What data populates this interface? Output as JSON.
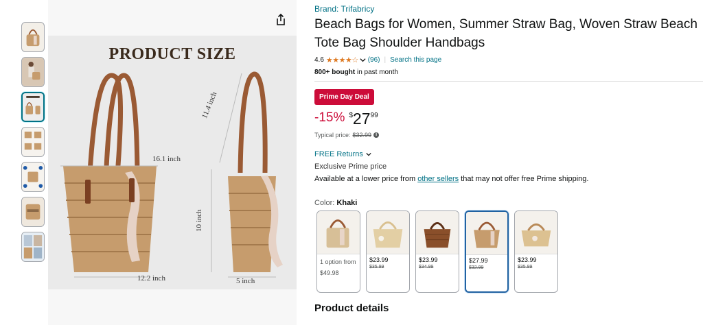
{
  "product": {
    "brand": "Brand: Trifabricy",
    "title": "Beach Bags for Women, Summer Straw Bag, Woven Straw Beach Tote Bag Shoulder Handbags",
    "rating": "4.6",
    "stars": "★★★★☆",
    "review_count": "(96)",
    "search_link": "Search this page",
    "bought_bold": "800+ bought",
    "bought_rest": " in past month"
  },
  "deal": {
    "badge": "Prime Day Deal",
    "discount": "-15%",
    "currency": "$",
    "whole": "27",
    "fraction": "99",
    "typical_label": "Typical price:",
    "typical_price": "$32.99",
    "info": "i"
  },
  "shipping": {
    "returns": "FREE Returns",
    "exclusive": "Exclusive Prime price",
    "lower_pre": "Available at a lower price from ",
    "lower_link": "other sellers",
    "lower_post": " that may not offer free Prime shipping."
  },
  "color": {
    "label": "Color: ",
    "selected": "Khaki",
    "options": [
      {
        "price": "1 option from $49.98",
        "strike": ""
      },
      {
        "price": "$23.99",
        "strike": "$35.99"
      },
      {
        "price": "$23.99",
        "strike": "$34.99"
      },
      {
        "price": "$27.99",
        "strike": "$32.99"
      },
      {
        "price": "$23.99",
        "strike": "$35.99"
      }
    ]
  },
  "image": {
    "title": "PRODUCT SIZE",
    "dims": {
      "width_top": "16.1 inch",
      "width_bottom": "12.2 inch",
      "strap": "11.4 inch",
      "height": "10 inch",
      "depth": "5 inch"
    }
  },
  "sections": {
    "details": "Product details"
  },
  "colors": {
    "link": "#007185",
    "deal_red": "#cc0c39",
    "star": "#de7921",
    "straw": "#c69c6d",
    "strap": "#9a5a34"
  }
}
